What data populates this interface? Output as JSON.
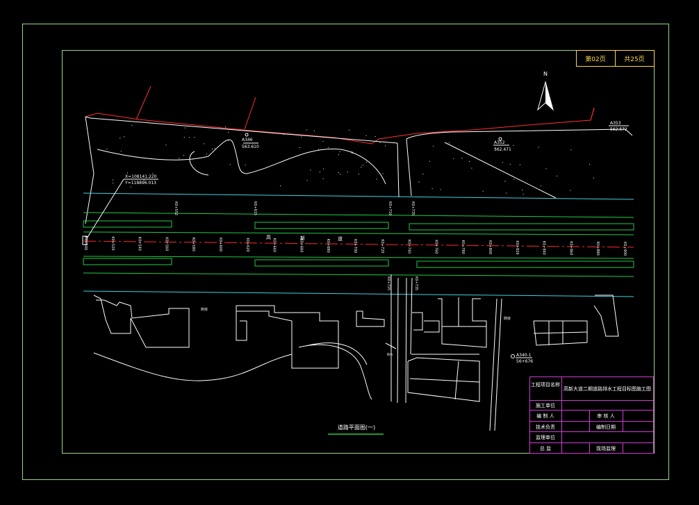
{
  "sheet": {
    "sheet_no": "第02页",
    "sheet_total": "共25页"
  },
  "north_arrow": {
    "label": "N"
  },
  "points": [
    {
      "id": "A346",
      "elev": "563.610"
    },
    {
      "id": "A352",
      "elev": "562.471"
    },
    {
      "id": "A353",
      "elev": "562.572"
    },
    {
      "id": "A340-1",
      "elev": "56+676"
    }
  ],
  "coordinate_callout": {
    "x": "X=108141.220",
    "y": "Y=118896.013"
  },
  "stations": [
    "K0+500",
    "K0+520",
    "K0+540",
    "K0+560",
    "K0+580",
    "K0+600",
    "K0+620",
    "K0+640",
    "K0+660",
    "K0+680",
    "K0+700",
    "K0+720",
    "K0+740",
    "K0+760",
    "K0+780",
    "K0+800",
    "K0+820",
    "K0+840",
    "K0+860",
    "K0+880",
    "K0+900"
  ],
  "road_name_chars": [
    "高",
    "新",
    "道"
  ],
  "misc_labels": {
    "left_label": "砖房",
    "right_label": "砖房",
    "width_label": "6m"
  },
  "drawing_title": "道路平面图(一)",
  "title_block": {
    "project_label": "工程项目名称",
    "project_name": "高新大道二期道路排水工程目标图施工图",
    "construction_unit": "施工单位",
    "drafter": "编 制 人",
    "reviewer": "审 核 人",
    "tech_lead": "技术负责",
    "date_label": "编制日期",
    "supervision_unit": "监理单位",
    "chief": "总  监",
    "site_supervisor": "现场监理"
  },
  "colors": {
    "frame": "#9bd48a",
    "road_cyan": "#3fd3e0",
    "road_green": "#22cc44",
    "centerline_red": "#ff2a2a",
    "boundary_red": "#ff3030",
    "title_block": "#d23cd2",
    "sheet_text": "#ffd84a"
  }
}
